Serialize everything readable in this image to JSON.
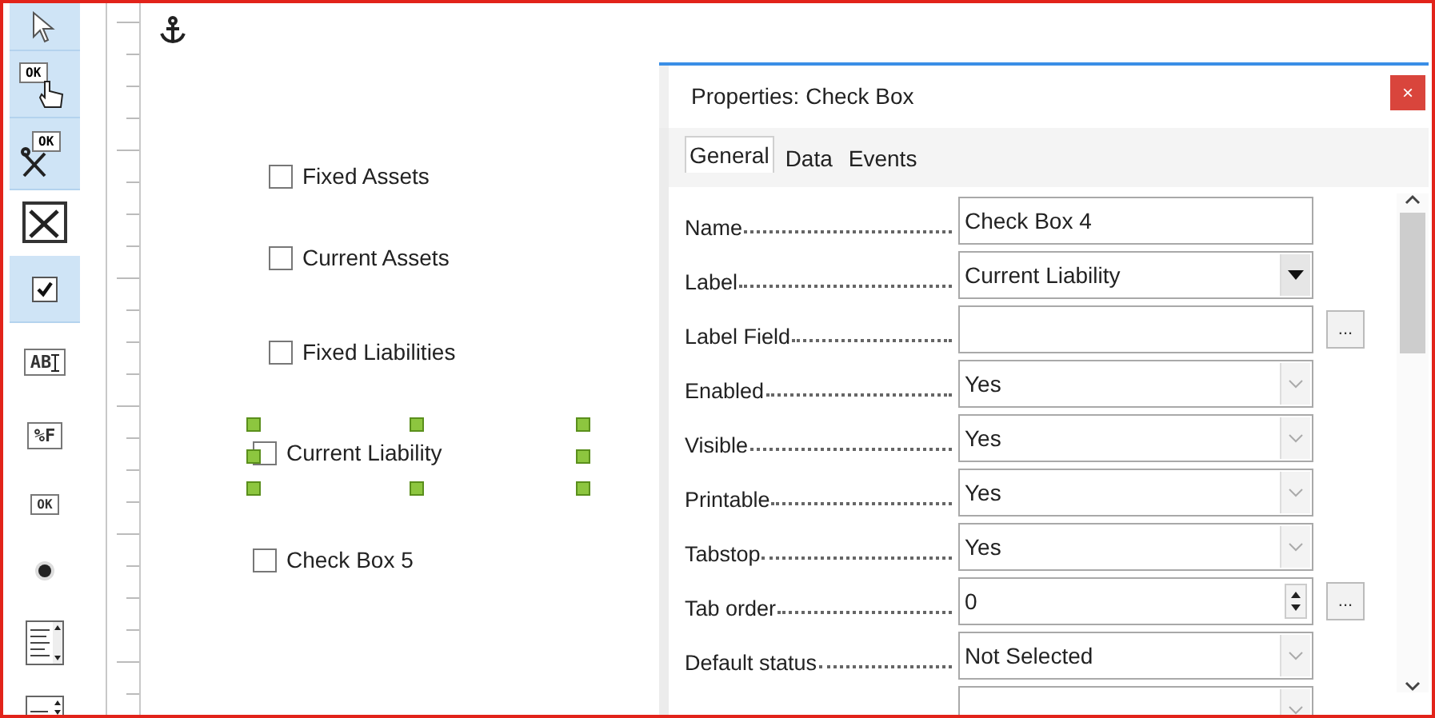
{
  "toolbar": [
    {
      "kind": "pointer",
      "selected": true
    },
    {
      "kind": "push",
      "text": "OK",
      "selected": true
    },
    {
      "kind": "tools",
      "text": "OK",
      "selected": true
    },
    {
      "kind": "wizard",
      "selected": false
    },
    {
      "kind": "checkbox",
      "selected": true
    },
    {
      "kind": "textfield",
      "text": "AB",
      "selected": false
    },
    {
      "kind": "formatted",
      "text": "%F",
      "selected": false
    },
    {
      "kind": "button",
      "text": "OK",
      "selected": false
    },
    {
      "kind": "radio",
      "selected": false
    },
    {
      "kind": "listbox",
      "selected": false
    },
    {
      "kind": "spin",
      "selected": false
    }
  ],
  "canvas": {
    "checkboxes": [
      {
        "label": "Fixed Assets",
        "checked": false,
        "selected": false
      },
      {
        "label": "Current Assets",
        "checked": false,
        "selected": false
      },
      {
        "label": "Fixed Liabilities",
        "checked": false,
        "selected": false
      },
      {
        "label": "Current Liability",
        "checked": false,
        "selected": true
      },
      {
        "label": "Check Box 5",
        "checked": false,
        "selected": false
      }
    ]
  },
  "properties": {
    "title": "Properties: Check Box",
    "close": "×",
    "tabs": [
      {
        "label": "General",
        "selected": true
      },
      {
        "label": "Data",
        "selected": false
      },
      {
        "label": "Events",
        "selected": false
      }
    ],
    "rows": [
      {
        "label": "Name",
        "kind": "text",
        "value": "Check Box 4"
      },
      {
        "label": "Label",
        "kind": "dropdown",
        "value": "Current Liability"
      },
      {
        "label": "Label Field",
        "kind": "text",
        "button": "..."
      },
      {
        "label": "Enabled",
        "kind": "listbox",
        "value": "Yes"
      },
      {
        "label": "Visible",
        "kind": "listbox",
        "value": "Yes"
      },
      {
        "label": "Printable",
        "kind": "listbox",
        "value": "Yes"
      },
      {
        "label": "Tabstop",
        "kind": "listbox",
        "value": "Yes"
      },
      {
        "label": "Tab order",
        "kind": "spin",
        "value": "0",
        "button": "..."
      },
      {
        "label": "Default status",
        "kind": "listbox",
        "value": "Not Selected"
      },
      {
        "kind": "listbox"
      }
    ]
  }
}
